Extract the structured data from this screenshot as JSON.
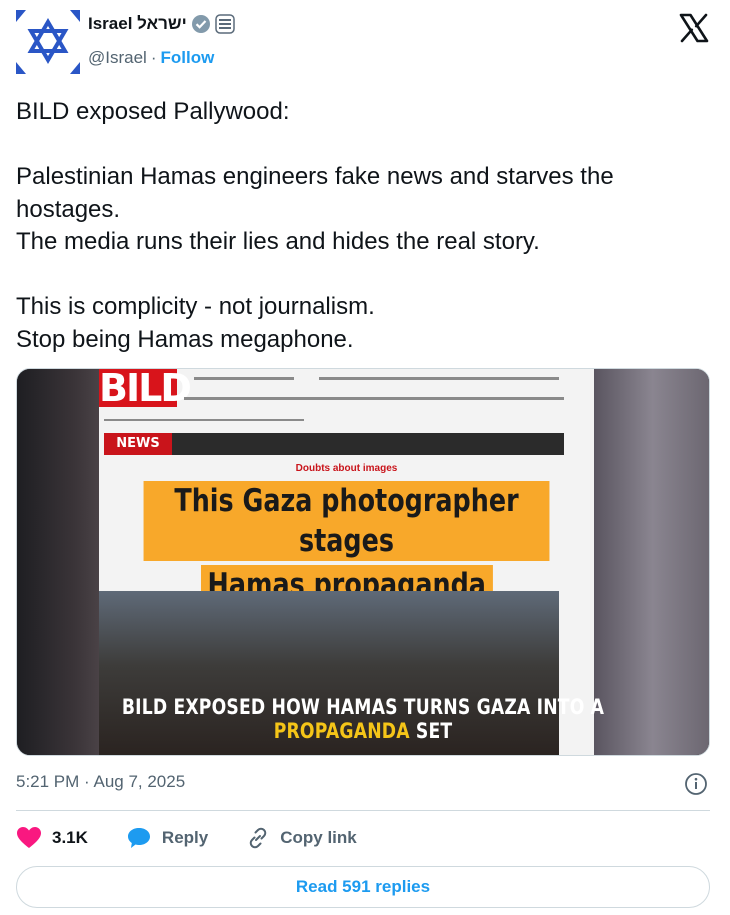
{
  "author": {
    "display_name": "Israel ישראל",
    "handle": "@Israel",
    "separator": "·",
    "follow_label": "Follow"
  },
  "tweet": {
    "text": "BILD exposed Pallywood:\n\nPalestinian Hamas engineers fake news and starves the hostages.\nThe media runs their lies and hides the real story.\n\nThis is complicity - not journalism.\nStop being Hamas megaphone.",
    "timestamp": "5:21 PM · Aug 7, 2025"
  },
  "media": {
    "bild_logo": "BILD",
    "news_badge": "NEWS",
    "kicker": "Doubts about images",
    "headline_line1": "This Gaza photographer stages",
    "headline_line2": "Hamas propaganda",
    "caption_before": "BILD EXPOSED HOW HAMAS TURNS GAZA INTO A ",
    "caption_highlight": "PROPAGANDA",
    "caption_after": " SET"
  },
  "actions": {
    "likes": "3.1K",
    "reply_label": "Reply",
    "copy_label": "Copy link"
  },
  "read_replies_label": "Read 591 replies",
  "colors": {
    "link_blue": "#1d9bf0",
    "like_pink": "#f91880",
    "headline_orange": "#f8a82a",
    "bild_red": "#d8141b"
  },
  "icons": [
    "star-of-david-avatar-icon",
    "verified-badge-icon",
    "government-affiliate-icon",
    "x-logo-icon",
    "info-icon",
    "heart-icon",
    "reply-bubble-icon",
    "link-icon"
  ]
}
